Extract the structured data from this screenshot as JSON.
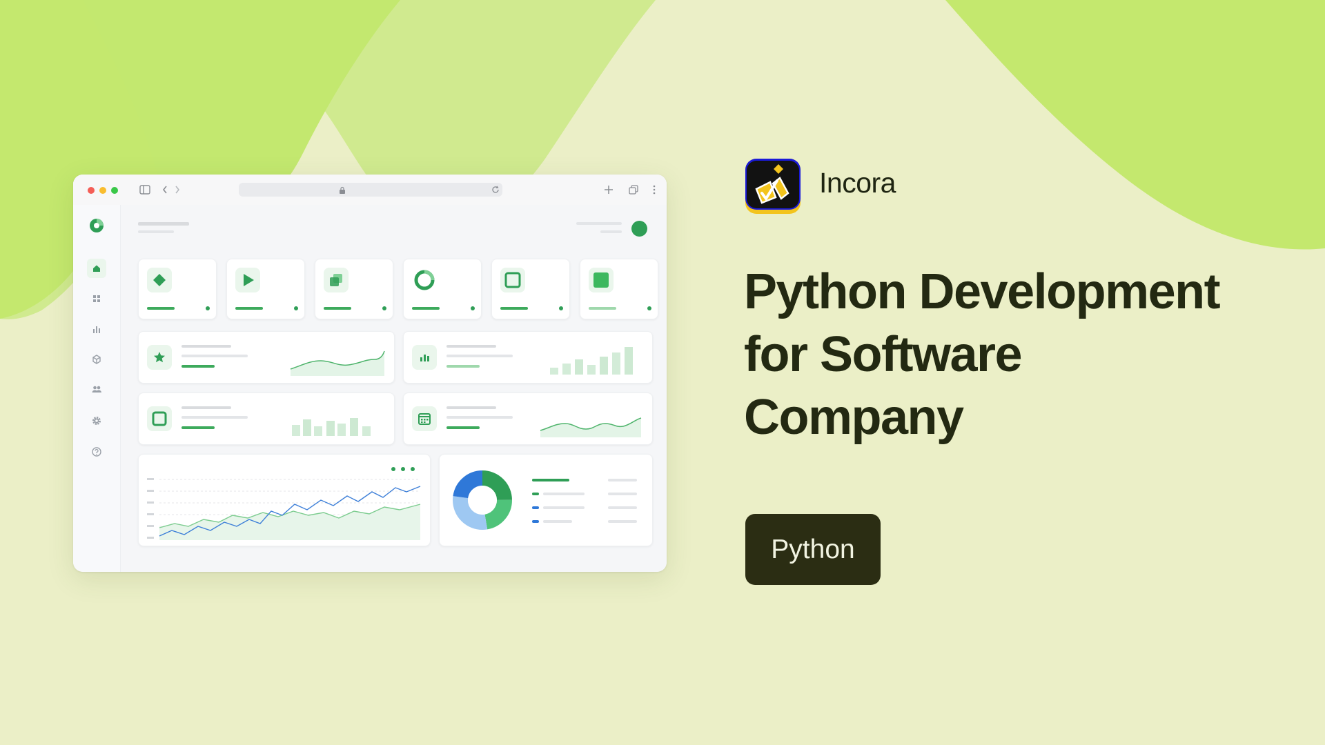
{
  "brand": {
    "name": "Incora",
    "logo_icon": "incora-logo-icon"
  },
  "headline": {
    "line1": "Python Development",
    "line2": "for Software",
    "line3": "Company"
  },
  "tag": {
    "label": "Python"
  },
  "colors": {
    "background": "#ebefc7",
    "wave_light": "#cfe88a",
    "wave_bright": "#c2e86c",
    "accent_green": "#3daa5c",
    "tag_bg": "#2b2d13",
    "heading_text": "#232912"
  },
  "browser": {
    "sidebar_icons": [
      "home-icon",
      "grid-icon",
      "bar-chart-icon",
      "cube-icon",
      "users-icon",
      "gear-icon",
      "help-icon"
    ],
    "stat_card_icons": [
      "diamond-icon",
      "play-icon",
      "copy-icon",
      "ring-icon",
      "square-outline-icon",
      "square-filled-icon"
    ],
    "wide_card_icons": [
      "star-icon",
      "bar-chart-icon",
      "square-outline-icon",
      "calendar-icon"
    ]
  }
}
